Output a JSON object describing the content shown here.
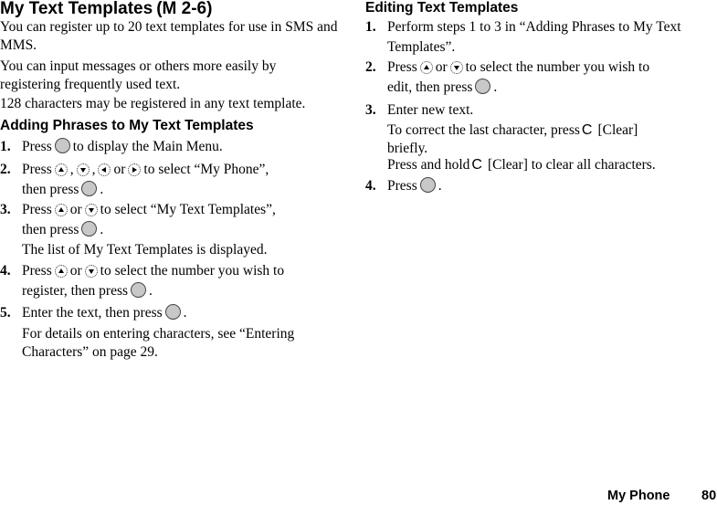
{
  "page": {
    "title": "My Text Templates",
    "menu_code": "(M 2-6)",
    "intro": [
      "You can register up to 20 text templates for use in SMS and MMS.",
      "You can input messages or others more easily by registering frequently used text.",
      "128 characters may be registered in any text template."
    ]
  },
  "adding": {
    "heading": "Adding Phrases to My Text Templates",
    "steps": [
      {
        "num": "1.",
        "pre": "Press",
        "post": "to display the Main Menu."
      },
      {
        "num": "2.",
        "pre": "Press",
        "sep1": ",",
        "sep2": ",",
        "or": "or",
        "post": "to select “My Phone”,",
        "line2": "then press",
        "end": "."
      },
      {
        "num": "3.",
        "pre": "Press",
        "or": "or",
        "post": "to select “My Text Templates”,",
        "line2": "then press",
        "end": "."
      },
      {
        "num": "4.",
        "pre": "Press",
        "or": "or",
        "post": "to select the number you wish to",
        "line2": "register, then press",
        "end": "."
      },
      {
        "num": "5.",
        "pre": "Enter the text, then press",
        "end": "."
      }
    ],
    "note3": "The list of My Text Templates is displayed.",
    "note5": "For details on entering characters, see “Entering Characters” on page 29."
  },
  "editing": {
    "heading": "Editing Text Templates",
    "steps": [
      {
        "num": "1.",
        "text": "Perform steps 1 to 3 in “Adding Phrases to My Text Templates”."
      },
      {
        "num": "2.",
        "pre": "Press",
        "or": "or",
        "post": "to select the number you wish to",
        "line2": "edit, then press",
        "end": "."
      },
      {
        "num": "3.",
        "text": "Enter new text."
      },
      {
        "num": "4.",
        "pre": "Press",
        "end": "."
      }
    ],
    "note3a_pre": "To correct the last character, press",
    "note3a_key": "C",
    "note3a_post": "[Clear] briefly.",
    "note3b_pre": "Press and hold",
    "note3b_key": "C",
    "note3b_post": "[Clear] to clear all characters."
  },
  "footer": {
    "section": "My Phone",
    "page_number": "80"
  }
}
